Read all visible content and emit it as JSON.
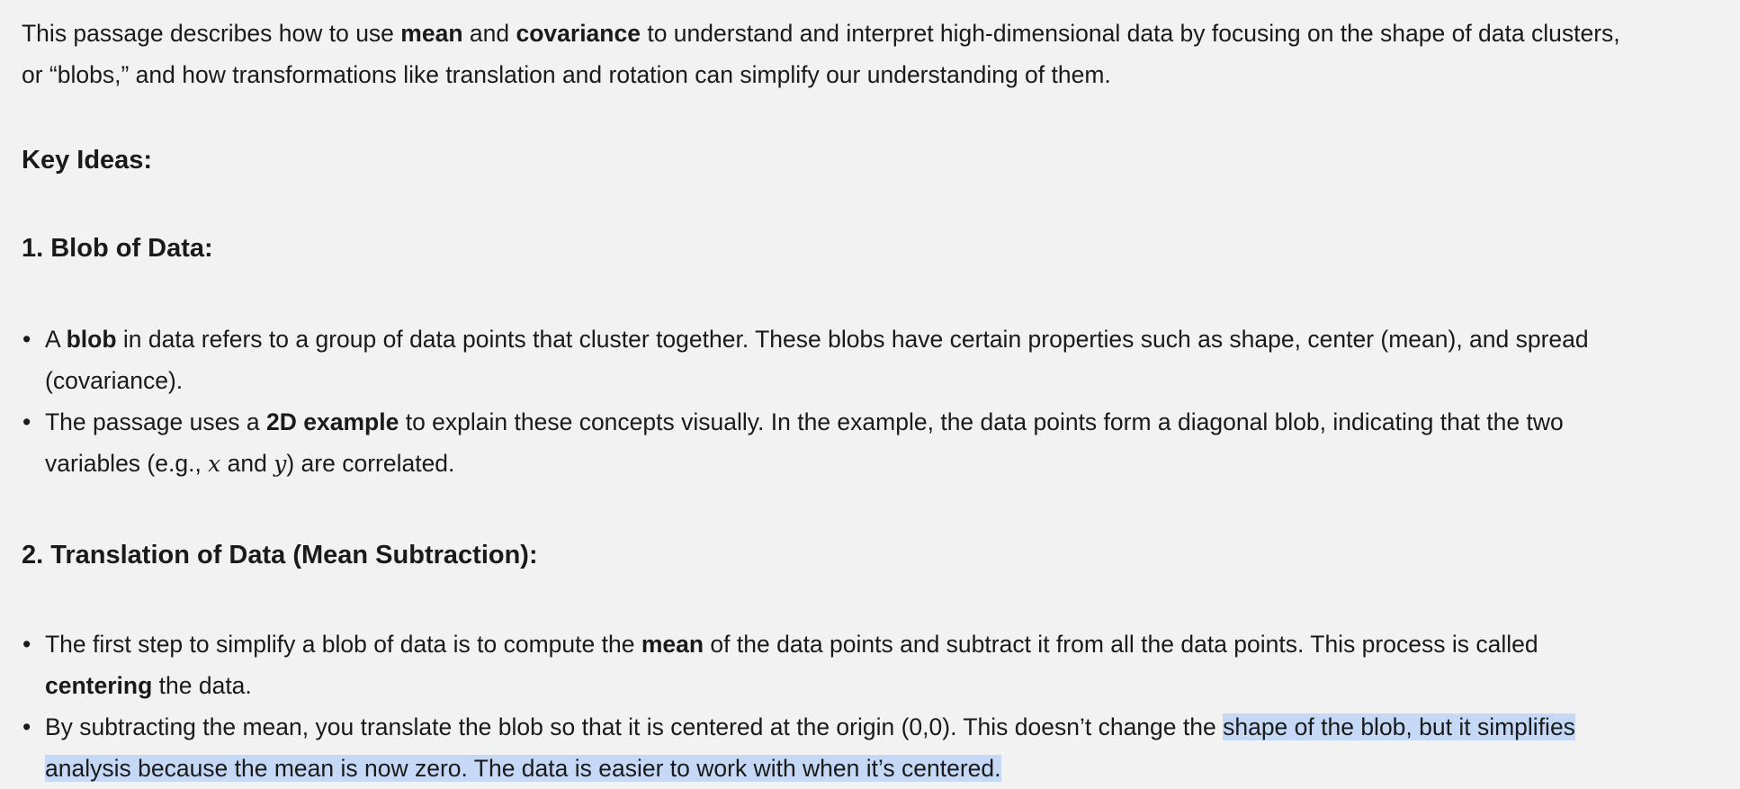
{
  "intro": {
    "t1": "This passage describes how to use ",
    "b1": "mean",
    "t2": " and ",
    "b2": "covariance",
    "t3": " to understand and interpret high-dimensional data by focusing on the shape of data clusters, or “blobs,” and how transformations like translation and rotation can simplify our understanding of them."
  },
  "key_ideas": "Key Ideas:",
  "section1": {
    "heading": "1. Blob of Data:",
    "items": [
      {
        "t1": "A ",
        "b1": "blob",
        "t2": " in data refers to a group of data points that cluster together. These blobs have certain properties such as shape, center (mean), and spread (covariance)."
      },
      {
        "t1": "The passage uses a ",
        "b1": "2D example",
        "t2": " to explain these concepts visually. In the example, the data points form a diagonal blob, indicating that the two variables (e.g., ",
        "m1": "x",
        "t3": " and ",
        "m2": "y",
        "t4": ") are correlated."
      }
    ]
  },
  "section2": {
    "heading": "2. Translation of Data (Mean Subtraction):",
    "items": [
      {
        "t1": "The first step to simplify a blob of data is to compute the ",
        "b1": "mean",
        "t2": " of the data points and subtract it from all the data points. This process is called ",
        "b2": "centering",
        "t3": " the data."
      },
      {
        "t1": "By subtracting the mean, you translate the blob so that it is centered at the origin (0,0). This doesn’t change the ",
        "hl": "shape of the blob, but it simplifies analysis because the mean is now zero. The data is easier to work with when it’s centered."
      }
    ]
  },
  "bullet": "•",
  "colors": {
    "background": "#f2f2f2",
    "text": "#1a1a1a",
    "selection": "#c5d9f6"
  }
}
